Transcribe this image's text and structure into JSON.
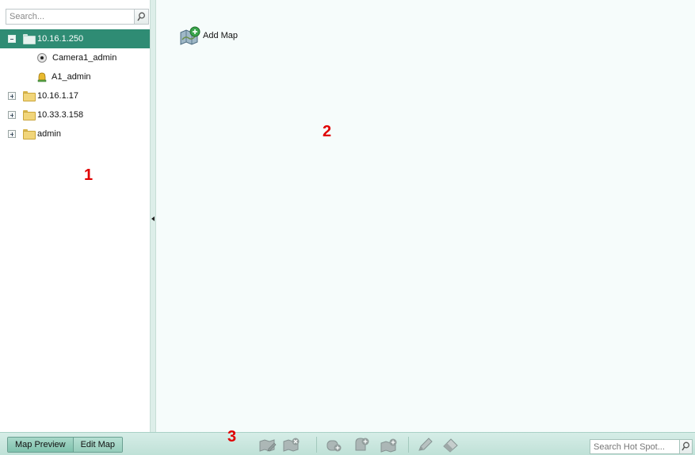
{
  "left_panel": {
    "search_placeholder": "Search...",
    "tree": [
      {
        "label": "10.16.1.250",
        "expanded": true,
        "selected": true,
        "children": [
          {
            "label": "Camera1_admin",
            "icon": "camera-icon"
          },
          {
            "label": "A1_admin",
            "icon": "alarm-input-icon"
          }
        ]
      },
      {
        "label": "10.16.1.17",
        "expanded": false
      },
      {
        "label": "10.33.3.158",
        "expanded": false
      },
      {
        "label": "admin",
        "expanded": false
      }
    ]
  },
  "main": {
    "add_map_label": "Add Map"
  },
  "annotations": {
    "one": "1",
    "two": "2",
    "three": "3"
  },
  "bottom_bar": {
    "tabs": [
      "Map Preview",
      "Edit Map"
    ],
    "toolbar_icons": [
      "modify-map-icon",
      "delete-map-icon",
      "add-camera-icon",
      "add-alarm-input-icon",
      "add-hot-region-icon",
      "modify-icon",
      "delete-icon"
    ],
    "hot_spot_search_placeholder": "Search Hot Spot..."
  },
  "colors": {
    "selected_node_bg": "#2f8c74",
    "annotation_red": "#e00000",
    "bottom_bar": "#c8e6dd"
  }
}
